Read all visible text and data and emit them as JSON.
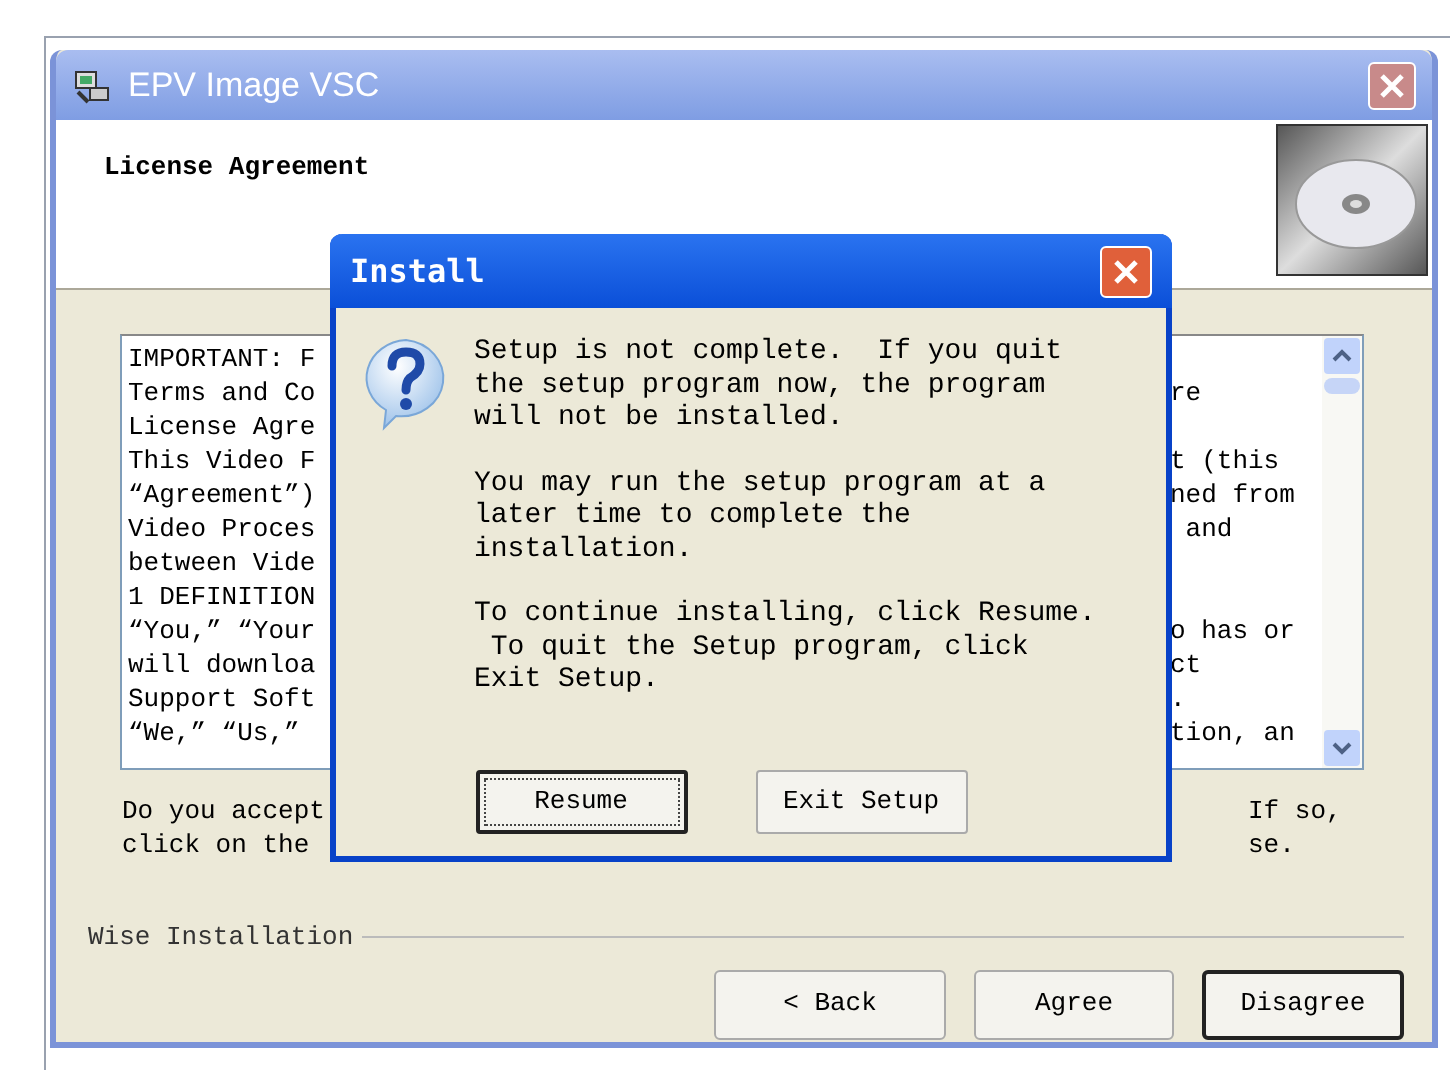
{
  "window": {
    "title": "EPV Image VSC"
  },
  "header": {
    "title": "License Agreement"
  },
  "license_text": {
    "lines": [
      {
        "left": "IMPORTANT: F"
      },
      {
        "left": "Terms and Co",
        "right": "re"
      },
      {
        "left": "License Agre"
      },
      {
        "left": "This Video F",
        "right": "t (this"
      },
      {
        "left": "“Agreement”)",
        "right": "ned from"
      },
      {
        "left": "Video Proces",
        "right": " and"
      },
      {
        "left": "between Vide"
      },
      {
        "left": "1 DEFINITION"
      },
      {
        "left": "“You,” “Your",
        "right": "o has or"
      },
      {
        "left": "will downloa",
        "right": "ct"
      },
      {
        "left": "Support Soft",
        "right": "."
      },
      {
        "left": "“We,” “Us,”",
        "right": "tion, an"
      }
    ]
  },
  "prompt": {
    "lines": [
      {
        "left": "Do you accept",
        "right": "If so,"
      },
      {
        "left": "click on the",
        "right": "se."
      }
    ]
  },
  "group_label": "Wise Installation",
  "buttons": [
    {
      "label": "< Back",
      "default": false
    },
    {
      "label": "Agree",
      "default": false
    },
    {
      "label": "Disagree",
      "default": true
    }
  ],
  "dialog": {
    "title": "Install",
    "paragraphs": [
      [
        "Setup is not complete.  If you quit",
        "the setup program now, the program",
        "will not be installed."
      ],
      [
        "You may run the setup program at a",
        "later time to complete the",
        "installation."
      ],
      [
        "To continue installing, click Resume.",
        " To quit the Setup program, click",
        "Exit Setup."
      ]
    ],
    "buttons": [
      {
        "label": "Resume",
        "focused": true
      },
      {
        "label": "Exit Setup",
        "focused": false
      }
    ]
  }
}
